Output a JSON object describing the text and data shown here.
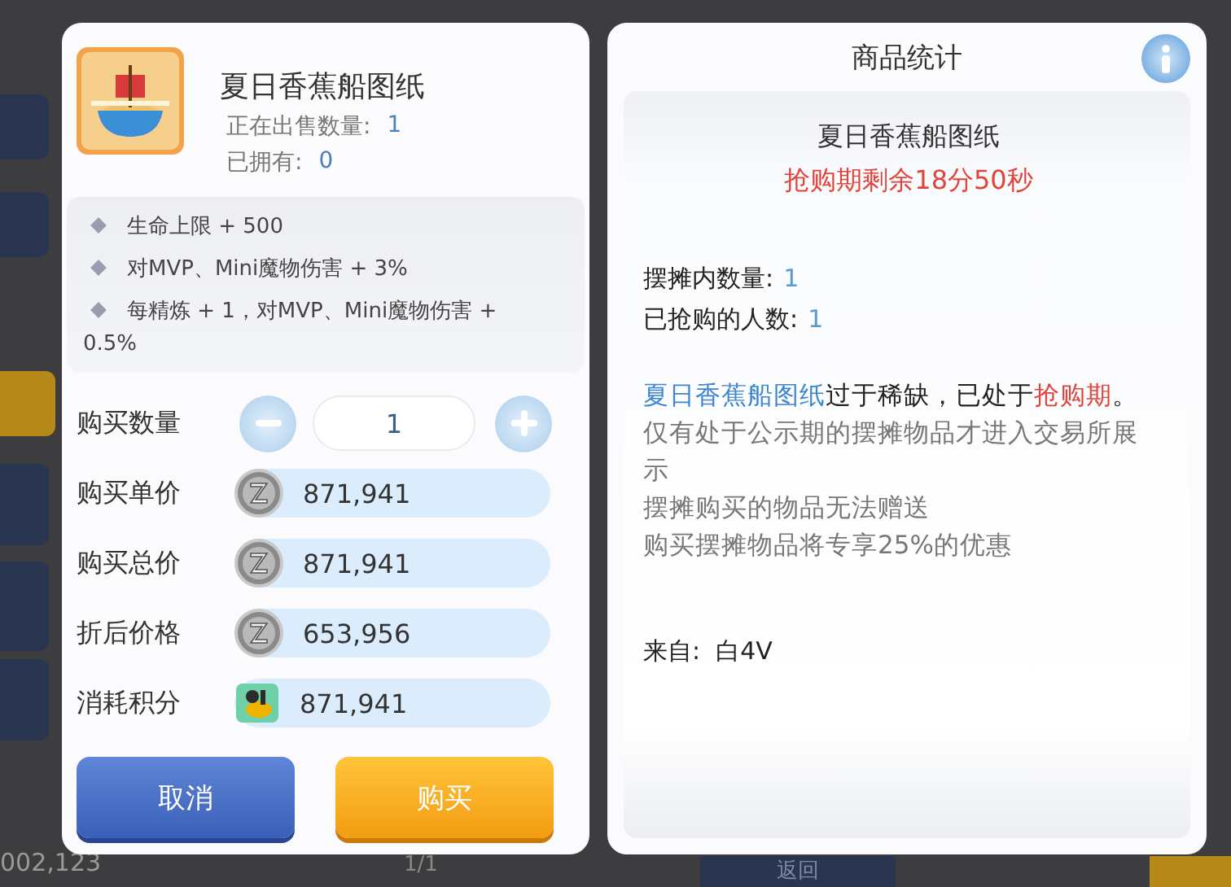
{
  "background": {
    "side_tabs": [
      {
        "selected": false
      },
      {
        "selected": false
      },
      {
        "selected": true
      },
      {
        "selected": false
      },
      {
        "selected": false
      },
      {
        "selected": false
      }
    ],
    "balance": "002,123",
    "page": "1/1",
    "back_button": "返回"
  },
  "purchase_panel": {
    "item": {
      "name": "夏日香蕉船图纸",
      "on_sale_label": "正在出售数量:",
      "on_sale_count": "1",
      "owned_label": "已拥有:",
      "owned_count": "0"
    },
    "effects": [
      "生命上限 + 500",
      "对MVP、Mini魔物伤害 + 3%",
      "每精炼 + 1，对MVP、Mini魔物伤害 + 0.5%"
    ],
    "quantity": {
      "label": "购买数量",
      "value": "1"
    },
    "price_rows": [
      {
        "label": "购买单价",
        "value": "871,941",
        "kind": "zeny"
      },
      {
        "label": "购买总价",
        "value": "871,941",
        "kind": "zeny"
      },
      {
        "label": "折后价格",
        "value": "653,956",
        "kind": "zeny"
      },
      {
        "label": "消耗积分",
        "value": "871,941",
        "kind": "points"
      }
    ],
    "buttons": [
      {
        "label": "取消",
        "kind": "cancel"
      },
      {
        "label": "购买",
        "kind": "confirm"
      }
    ]
  },
  "stats_panel": {
    "title": "商品统计",
    "item_name": "夏日香蕉船图纸",
    "countdown": "抢购期剩余18分50秒",
    "stats": [
      {
        "label": "摆摊内数量:",
        "value": "1"
      },
      {
        "label": "已抢购的人数:",
        "value": "1"
      }
    ],
    "notice": [
      {
        "text": "夏日香蕉船图纸",
        "kind": "item"
      },
      {
        "text": "过于稀缺，已处于",
        "kind": "plain"
      },
      {
        "text": "抢购期",
        "kind": "alert"
      },
      {
        "text": "。",
        "kind": "plain"
      }
    ],
    "notes": [
      "仅有处于公示期的摆摊物品才进入交易所展示",
      "摆摊购买的物品无法赠送",
      "购买摆摊物品将专享25%的优惠"
    ],
    "source": "来自:  白4V"
  }
}
